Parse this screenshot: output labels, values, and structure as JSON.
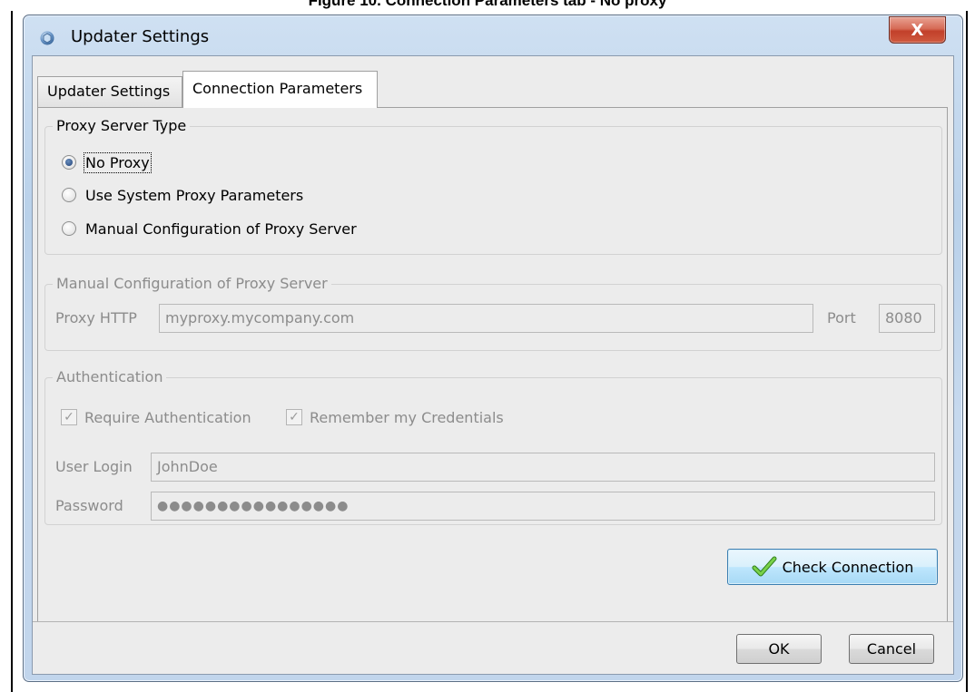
{
  "caption": "Figure 10. Connection Parameters tab - No proxy",
  "window": {
    "title": "Updater Settings",
    "close_label": "X"
  },
  "tabs": [
    {
      "label": "Updater Settings",
      "active": false
    },
    {
      "label": "Connection Parameters",
      "active": true
    }
  ],
  "proxy_type": {
    "title": "Proxy Server Type",
    "options": [
      {
        "label": "No Proxy",
        "checked": true
      },
      {
        "label": "Use System Proxy Parameters",
        "checked": false
      },
      {
        "label": "Manual Configuration of Proxy Server",
        "checked": false
      }
    ]
  },
  "manual_config": {
    "title": "Manual Configuration of Proxy Server",
    "proxy_label": "Proxy HTTP",
    "proxy_value": "myproxy.mycompany.com",
    "port_label": "Port",
    "port_value": "8080"
  },
  "authentication": {
    "title": "Authentication",
    "require_label": "Require Authentication",
    "remember_label": "Remember my Credentials",
    "user_label": "User Login",
    "user_value": "JohnDoe",
    "password_label": "Password",
    "password_value": "●●●●●●●●●●●●●●●●"
  },
  "buttons": {
    "check_connection": "Check Connection",
    "ok": "OK",
    "cancel": "Cancel"
  },
  "colors": {
    "frame": "#c1d5ec",
    "client": "#ececec",
    "focus_button": "#a7d9f5",
    "check_icon": "#5cb531"
  }
}
